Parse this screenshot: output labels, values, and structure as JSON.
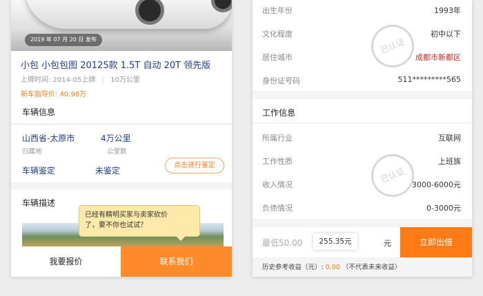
{
  "listing": {
    "date_badge": "2019 年 07 月 20 日  发布",
    "title": "小包 小包包图 20125款 1.5T 自动 20T 领先版",
    "plate_date": "上牌时间:  2014-05上牌",
    "mileage_sub": "10万公里",
    "guide_price": "新车指导价:  40.98万",
    "vehicle_info_heading": "车辆信息",
    "location_value": "山西省-太原市",
    "location_label": "归属地",
    "km_value": "4万公里",
    "km_label": "公里数",
    "appraisal_label": "车辆鉴定",
    "appraisal_status": "未鉴定",
    "appraise_button": "点击进行鉴定",
    "description_heading": "车辆描述",
    "tooltip_line1": "已经有精明买家与卖家砍价",
    "tooltip_line2": "了，要不你也试试？",
    "quote_button": "我要报价",
    "contact_button": "联系我们"
  },
  "profile": {
    "rows_top": [
      {
        "label": "出生年份",
        "value": "1993年"
      },
      {
        "label": "文化程度",
        "value": "初中以下"
      },
      {
        "label": "居住城市",
        "value": "成都市新都区"
      },
      {
        "label": "身份证号码",
        "value": "511*********565"
      }
    ],
    "work_heading": "工作信息",
    "rows_work": [
      {
        "label": "所属行业",
        "value": "互联网"
      },
      {
        "label": "工作性质",
        "value": "上班族"
      },
      {
        "label": "收入情况",
        "value": "3000-6000元"
      },
      {
        "label": "负债情况",
        "value": "0-3000元"
      }
    ],
    "stamp_text": "已认证",
    "min_label": "最低50.00",
    "amount_value": "255.35元",
    "unit": "元",
    "lend_button": "立即出借",
    "note_prefix": "历史参考收益（元）:",
    "note_value": "0.00",
    "note_suffix": "（不代表未来收益）"
  },
  "colors": {
    "accent": "#ff7a14",
    "title_blue": "#1f3d8a",
    "tooltip": "#fde9a9"
  }
}
